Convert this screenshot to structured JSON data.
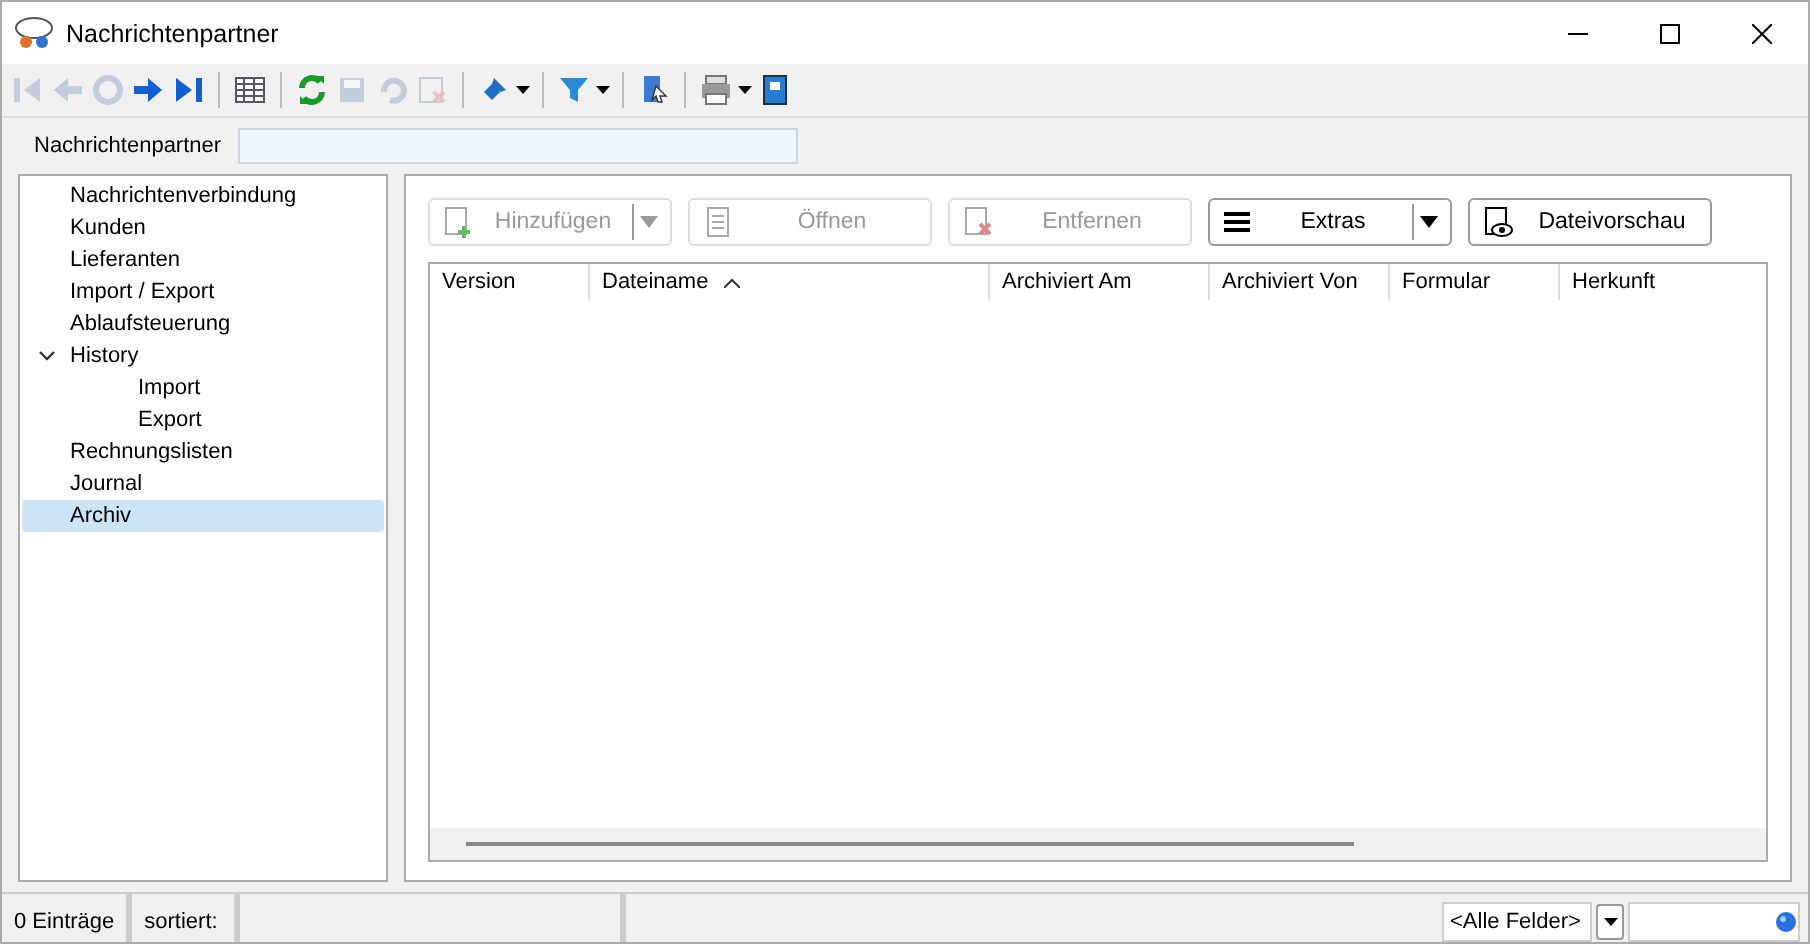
{
  "window": {
    "title": "Nachrichtenpartner"
  },
  "toolbar": [
    {
      "disabled": true
    },
    {
      "disabled": true
    },
    {
      "disabled": true
    },
    {
      "disabled": false
    },
    {
      "disabled": false
    },
    {
      "disabled": false
    },
    {
      "disabled": false
    },
    {
      "disabled": true
    },
    {
      "disabled": true
    },
    {
      "disabled": true
    },
    {
      "disabled": false
    },
    {
      "disabled": false
    },
    {
      "disabled": false
    },
    {
      "disabled": false
    },
    {
      "disabled": false
    }
  ],
  "filter": {
    "label": "Nachrichtenpartner"
  },
  "tree": [
    {
      "label": "Nachrichtenverbindung",
      "selected": false
    },
    {
      "label": "Kunden",
      "selected": false
    },
    {
      "label": "Lieferanten",
      "selected": false
    },
    {
      "label": "Import / Export",
      "selected": false
    },
    {
      "label": "Ablaufsteuerung",
      "selected": false
    },
    {
      "label": "History",
      "selected": false,
      "expanded": true,
      "children": [
        {
          "label": "Import",
          "selected": false
        },
        {
          "label": "Export",
          "selected": false
        }
      ]
    },
    {
      "label": "Rechnungslisten",
      "selected": false
    },
    {
      "label": "Journal",
      "selected": false
    },
    {
      "label": "Archiv",
      "selected": true
    }
  ],
  "actions": [
    {
      "label": "Hinzufügen",
      "disabled": true,
      "dropdown": true
    },
    {
      "label": "Öffnen",
      "disabled": true,
      "dropdown": false
    },
    {
      "label": "Entfernen",
      "disabled": true,
      "dropdown": false
    },
    {
      "label": "Extras",
      "disabled": false,
      "dropdown": true
    },
    {
      "label": "Dateivorschau",
      "disabled": false,
      "dropdown": false
    }
  ],
  "table": {
    "columns": [
      {
        "label": "Version",
        "sorted": false
      },
      {
        "label": "Dateiname",
        "sorted": true
      },
      {
        "label": "Archiviert Am",
        "sorted": false
      },
      {
        "label": "Archiviert Von",
        "sorted": false
      },
      {
        "label": "Formular",
        "sorted": false
      },
      {
        "label": "Herkunft",
        "sorted": false
      }
    ]
  },
  "status_bar": {
    "count": "0 Einträge",
    "sort": "sortiert:",
    "field": "<Alle Felder>"
  }
}
